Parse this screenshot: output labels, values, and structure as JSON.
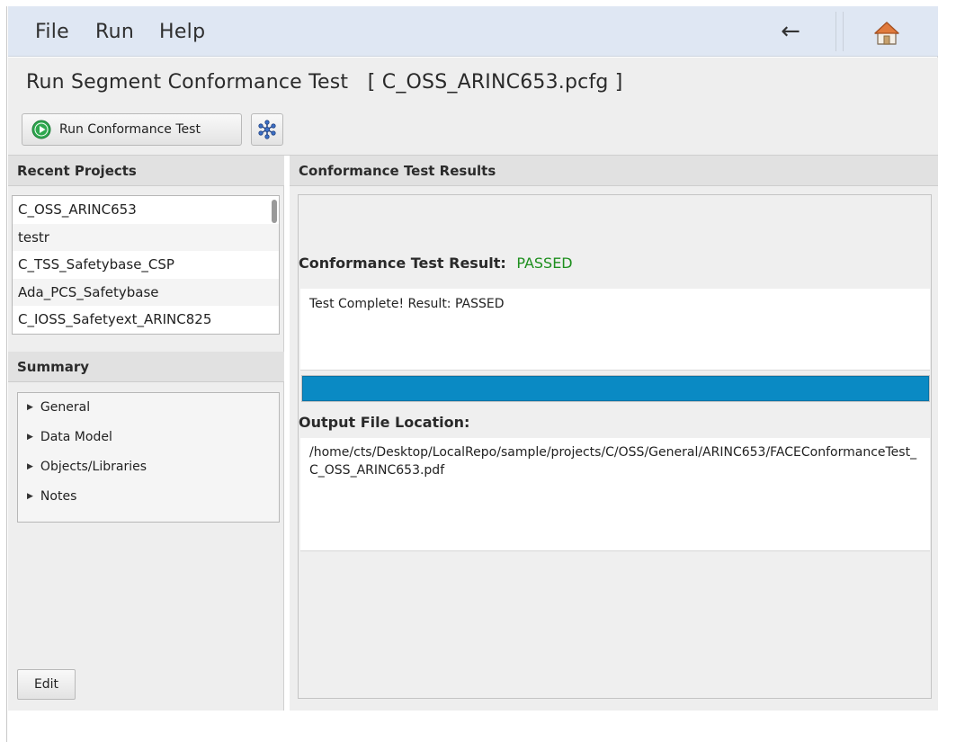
{
  "menu": {
    "file_label": "File",
    "run_label": "Run",
    "help_label": "Help",
    "back_icon": "←"
  },
  "page": {
    "title": "Run Segment Conformance Test   [ C_OSS_ARINC653.pcfg ]"
  },
  "toolbar": {
    "run_label": "Run Conformance Test",
    "run_icon": "play-circle-icon",
    "second_icon": "snowflake-network-icon"
  },
  "recent": {
    "header": "Recent Projects",
    "items": [
      "C_OSS_ARINC653",
      "testr",
      "C_TSS_Safetybase_CSP",
      "Ada_PCS_Safetybase",
      "C_IOSS_Safetyext_ARINC825"
    ]
  },
  "summary": {
    "header": "Summary",
    "items": [
      "General",
      "Data Model",
      "Objects/Libraries",
      "Notes"
    ],
    "edit_label": "Edit"
  },
  "results": {
    "header": "Conformance Test Results",
    "result_label": "Conformance Test Result:",
    "result_status": "PASSED",
    "result_text": "Test Complete! Result:  PASSED",
    "progress_percent": 100,
    "output_label": "Output File Location:",
    "output_path": "/home/cts/Desktop/LocalRepo/sample/projects/C/OSS/General/ARINC653/FACEConformanceTest_C_OSS_ARINC653.pdf"
  },
  "colors": {
    "menubar_bg": "#dfe7f3",
    "passed_green": "#1e8f1e",
    "progress_blue": "#0a8ac4",
    "play_green": "#2fa84f"
  }
}
